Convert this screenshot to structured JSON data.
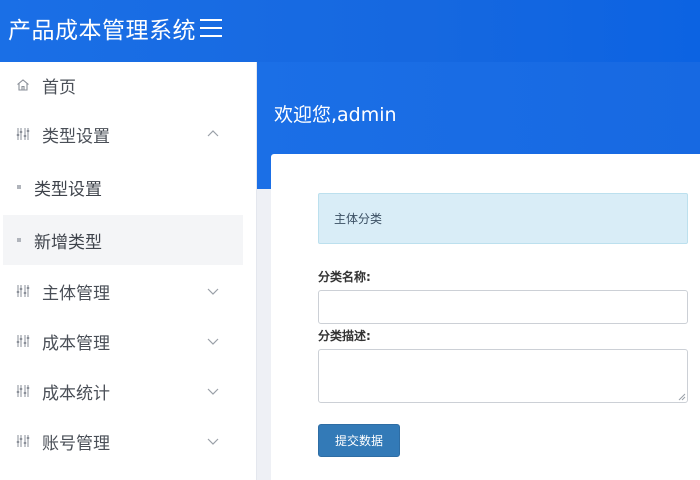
{
  "header": {
    "app_title": "产品成本管理系统",
    "menu_icon": "hamburger-icon"
  },
  "sidebar": {
    "items": [
      {
        "label": "首页",
        "icon": "home-icon",
        "expanded": null
      },
      {
        "label": "类型设置",
        "icon": "sliders-icon",
        "expanded": true,
        "children": [
          {
            "label": "类型设置"
          },
          {
            "label": "新增类型",
            "active": true
          }
        ]
      },
      {
        "label": "主体管理",
        "icon": "sliders-icon",
        "expanded": false
      },
      {
        "label": "成本管理",
        "icon": "sliders-icon",
        "expanded": false
      },
      {
        "label": "成本统计",
        "icon": "sliders-icon",
        "expanded": false
      },
      {
        "label": "账号管理",
        "icon": "sliders-icon",
        "expanded": false
      }
    ]
  },
  "main": {
    "welcome": "欢迎您,admin",
    "alert_text": "主体分类",
    "form": {
      "name_label": "分类名称:",
      "name_value": "",
      "desc_label": "分类描述:",
      "desc_value": "",
      "submit_label": "提交数据"
    }
  },
  "colors": {
    "header_blue": "#1a6fe6",
    "alert_bg": "#d9edf7",
    "button_blue": "#337ab7"
  }
}
